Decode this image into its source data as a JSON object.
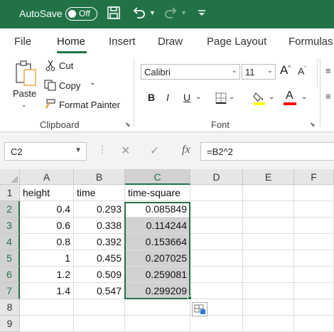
{
  "titlebar": {
    "autosave_label": "AutoSave",
    "autosave_state": "Off",
    "save_icon": "save-icon",
    "undo_icon": "undo-icon",
    "redo_icon": "redo-icon"
  },
  "tabs": [
    "File",
    "Home",
    "Insert",
    "Draw",
    "Page Layout",
    "Formulas"
  ],
  "active_tab": "Home",
  "clipboard": {
    "paste": "Paste",
    "cut": "Cut",
    "copy": "Copy",
    "format_painter": "Format Painter",
    "group_label": "Clipboard"
  },
  "font": {
    "font_name": "Calibri",
    "font_size": "11",
    "bold": "B",
    "italic": "I",
    "underline": "U",
    "font_color_letter": "A",
    "grow_font": "A",
    "shrink_font": "A",
    "group_label": "Font",
    "highlight_color": "#FFFF00",
    "font_color": "#FF0000"
  },
  "formula_bar": {
    "name_box": "C2",
    "fx_label": "fx",
    "formula": "=B2^2"
  },
  "grid": {
    "columns": [
      "A",
      "B",
      "C",
      "D",
      "E",
      "F"
    ],
    "rows": [
      "1",
      "2",
      "3",
      "4",
      "5",
      "6",
      "7",
      "8",
      "9"
    ],
    "cells": {
      "A1": "height",
      "B1": "time",
      "C1": "time-square",
      "A2": "0.4",
      "B2": "0.293",
      "C2": "0.085849",
      "A3": "0.6",
      "B3": "0.338",
      "C3": "0.114244",
      "A4": "0.8",
      "B4": "0.392",
      "C4": "0.153664",
      "A5": "1",
      "B5": "0.455",
      "C5": "0.207025",
      "A6": "1.2",
      "B6": "0.509",
      "C6": "0.259081",
      "A7": "1.4",
      "B7": "0.547",
      "C7": "0.299209"
    },
    "selected_range": "C2:C7",
    "accent_color": "#217346"
  }
}
